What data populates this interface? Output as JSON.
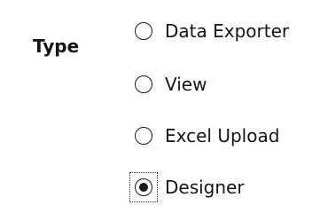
{
  "field": {
    "label": "Type"
  },
  "radio_options": [
    {
      "label": "Data Exporter",
      "checked": false
    },
    {
      "label": "View",
      "checked": false
    },
    {
      "label": "Excel Upload",
      "checked": false
    },
    {
      "label": "Designer",
      "checked": true
    }
  ],
  "icons": {
    "radio_unchecked": "radio-unchecked-icon",
    "radio_checked": "radio-checked-icon"
  },
  "colors": {
    "text": "#161513",
    "radio_border": "#1a1a1a",
    "focus_outline": "#303030",
    "background": "#ffffff"
  }
}
